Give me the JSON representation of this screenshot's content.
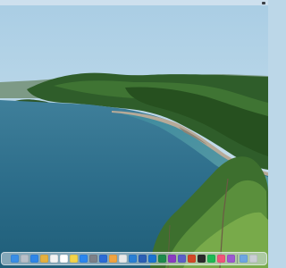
{
  "menubar": {
    "status_icons": [
      "control-center-icon",
      "apple-logo-icon"
    ]
  },
  "dock": {
    "apps": [
      {
        "name": "finder-icon",
        "color": "#3a8ee6"
      },
      {
        "name": "launchpad-icon",
        "color": "#b8bfc8"
      },
      {
        "name": "safari-icon",
        "color": "#2f86e8"
      },
      {
        "name": "photos-icon",
        "color": "#e4b040"
      },
      {
        "name": "calendar-icon",
        "color": "#f2f2f2"
      },
      {
        "name": "reminders-icon",
        "color": "#ffffff"
      },
      {
        "name": "notes-icon",
        "color": "#f3d34a"
      },
      {
        "name": "app-store-icon",
        "color": "#2b86ee"
      },
      {
        "name": "system-settings-icon",
        "color": "#7b8088"
      },
      {
        "name": "music-icon",
        "color": "#2c6bd6"
      },
      {
        "name": "podcasts-icon",
        "color": "#f0a340"
      },
      {
        "name": "slack-icon",
        "color": "#e9e9e9"
      },
      {
        "name": "vscode-icon",
        "color": "#2a7fd4"
      },
      {
        "name": "word-icon",
        "color": "#2b5fb5"
      },
      {
        "name": "outlook-icon",
        "color": "#1b73d0"
      },
      {
        "name": "excel-icon",
        "color": "#1f8a4c"
      },
      {
        "name": "onenote-icon",
        "color": "#8a3cc0"
      },
      {
        "name": "teams-icon",
        "color": "#5b5fc7"
      },
      {
        "name": "powerpoint-icon",
        "color": "#d24726"
      },
      {
        "name": "terminal-icon",
        "color": "#2b2b2b"
      },
      {
        "name": "spotify-icon",
        "color": "#1db954"
      },
      {
        "name": "itunes-icon",
        "color": "#f0547a"
      },
      {
        "name": "podcast-icon",
        "color": "#9b59d0"
      }
    ],
    "extras": [
      {
        "name": "downloads-icon",
        "color": "#6da6e2"
      },
      {
        "name": "trash-icon",
        "color": "#c9ced4"
      }
    ]
  }
}
